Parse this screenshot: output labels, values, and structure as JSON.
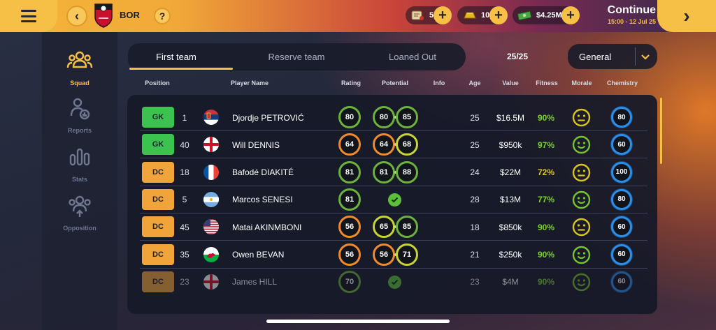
{
  "header": {
    "club_abbr": "BOR",
    "help": "?",
    "back": "‹",
    "continue_label": "Continue",
    "continue_date": "15:00 - 12 Jul 25",
    "continue_arrow": "›"
  },
  "currencies": [
    {
      "name": "scout-packs",
      "icon": "scroll-icon",
      "value": "5"
    },
    {
      "name": "gold-bars",
      "icon": "gold-bar-icon",
      "value": "10"
    },
    {
      "name": "cash",
      "icon": "cash-icon",
      "value": "$4.25M"
    }
  ],
  "sidebar": {
    "items": [
      {
        "label": "Squad",
        "icon": "squad-icon",
        "active": true
      },
      {
        "label": "Reports",
        "icon": "reports-icon",
        "active": false
      },
      {
        "label": "Stats",
        "icon": "stats-icon",
        "active": false
      },
      {
        "label": "Opposition",
        "icon": "opposition-icon",
        "active": false
      }
    ]
  },
  "tabs": [
    {
      "label": "First team",
      "active": true
    },
    {
      "label": "Reserve team",
      "active": false
    },
    {
      "label": "Loaned Out",
      "active": false
    }
  ],
  "squad_count": "25/25",
  "view_select": {
    "value": "General"
  },
  "columns": [
    "Position",
    "Player Name",
    "Rating",
    "Potential",
    "Info",
    "Age",
    "Value",
    "Fitness",
    "Morale",
    "Chemistry"
  ],
  "colors": {
    "gk": "#3cc24e",
    "def": "#f0a43a",
    "ring_green": "#6cb23c",
    "ring_orange": "#f08a2a",
    "ring_yellowgreen": "#c7d431",
    "fit_green": "#7ad22f",
    "fit_yellow": "#e2c72a",
    "morale_yellow": "#d7c41f",
    "morale_green": "#74c52c",
    "accent": "#f6c046"
  },
  "players": [
    {
      "position": "GK",
      "number": "1",
      "flag": "serbia",
      "name": "Djordje PETROVIĆ",
      "rating": "80",
      "rating_color": "ring_green",
      "potential": [
        "80",
        "85"
      ],
      "pot_colors": [
        "ring_green",
        "ring_green"
      ],
      "age": "25",
      "value": "$16.5M",
      "fitness": "90%",
      "fitness_color": "fit_green",
      "morale": "neutral",
      "morale_color": "morale_yellow",
      "chemistry": "80"
    },
    {
      "position": "GK",
      "number": "40",
      "flag": "england",
      "name": "Will DENNIS",
      "rating": "64",
      "rating_color": "ring_orange",
      "potential": [
        "64",
        "68"
      ],
      "pot_colors": [
        "ring_orange",
        "ring_yellowgreen"
      ],
      "age": "25",
      "value": "$950k",
      "fitness": "97%",
      "fitness_color": "fit_green",
      "morale": "happy",
      "morale_color": "morale_green",
      "chemistry": "60"
    },
    {
      "position": "DC",
      "number": "18",
      "flag": "france",
      "name": "Bafodé DIAKITÉ",
      "rating": "81",
      "rating_color": "ring_green",
      "potential": [
        "81",
        "88"
      ],
      "pot_colors": [
        "ring_green",
        "ring_green"
      ],
      "age": "24",
      "value": "$22M",
      "fitness": "72%",
      "fitness_color": "fit_yellow",
      "morale": "neutral",
      "morale_color": "morale_yellow",
      "chemistry": "100"
    },
    {
      "position": "DC",
      "number": "5",
      "flag": "argentina",
      "name": "Marcos SENESI",
      "rating": "81",
      "rating_color": "ring_green",
      "potential": [],
      "pot_colors": [],
      "age": "28",
      "value": "$13M",
      "fitness": "77%",
      "fitness_color": "fit_green",
      "morale": "happy",
      "morale_color": "morale_green",
      "chemistry": "80"
    },
    {
      "position": "DC",
      "number": "45",
      "flag": "usa",
      "name": "Matai AKINMBONI",
      "rating": "56",
      "rating_color": "ring_orange",
      "potential": [
        "65",
        "85"
      ],
      "pot_colors": [
        "ring_yellowgreen",
        "ring_green"
      ],
      "age": "18",
      "value": "$850k",
      "fitness": "90%",
      "fitness_color": "fit_green",
      "morale": "neutral",
      "morale_color": "morale_yellow",
      "chemistry": "60"
    },
    {
      "position": "DC",
      "number": "35",
      "flag": "wales",
      "name": "Owen BEVAN",
      "rating": "56",
      "rating_color": "ring_orange",
      "potential": [
        "56",
        "71"
      ],
      "pot_colors": [
        "ring_orange",
        "ring_yellowgreen"
      ],
      "age": "21",
      "value": "$250k",
      "fitness": "90%",
      "fitness_color": "fit_green",
      "morale": "happy",
      "morale_color": "morale_green",
      "chemistry": "60"
    },
    {
      "position": "DC",
      "number": "23",
      "flag": "england",
      "name": "James HILL",
      "rating": "70",
      "rating_color": "ring_green",
      "potential": [],
      "pot_colors": [],
      "age": "23",
      "value": "$4M",
      "fitness": "90%",
      "fitness_color": "fit_green",
      "morale": "happy",
      "morale_color": "morale_green",
      "chemistry": "60"
    }
  ]
}
